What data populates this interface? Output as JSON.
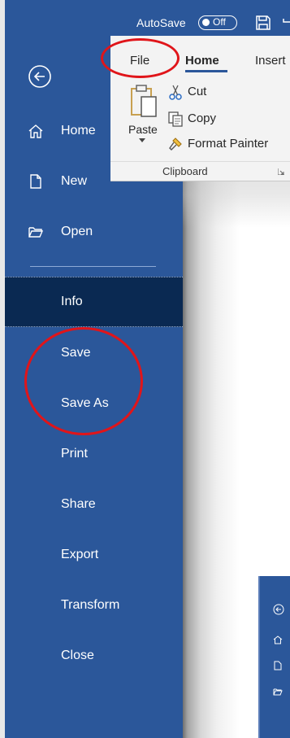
{
  "quick_access": {
    "autosave_label": "AutoSave",
    "autosave_state": "Off"
  },
  "ribbon": {
    "tabs": [
      "File",
      "Home",
      "Insert"
    ],
    "active_tab": "Home",
    "paste_label": "Paste",
    "commands": {
      "cut": "Cut",
      "copy": "Copy",
      "format_painter": "Format Painter"
    },
    "group_label": "Clipboard"
  },
  "backstage": {
    "nav_top": [
      {
        "label": "Home",
        "icon": "home-icon"
      },
      {
        "label": "New",
        "icon": "new-document-icon"
      },
      {
        "label": "Open",
        "icon": "open-folder-icon"
      }
    ],
    "nav_bottom": [
      "Info",
      "Save",
      "Save As",
      "Print",
      "Share",
      "Export",
      "Transform",
      "Close"
    ],
    "selected": "Info"
  },
  "colors": {
    "sidebar": "#2b579a",
    "selected": "#0a2952",
    "annotation": "#e0151a"
  }
}
